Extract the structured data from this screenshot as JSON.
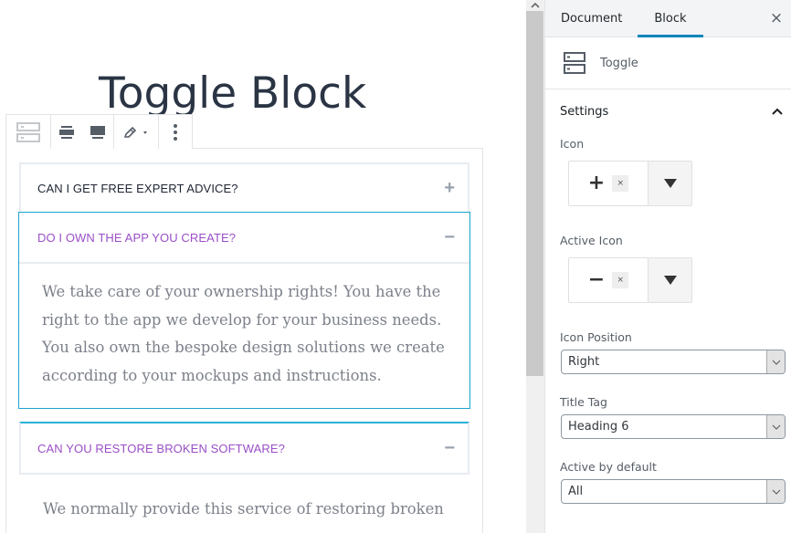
{
  "editor": {
    "post_title": "Toggle Block",
    "toolbar": {
      "block_type_icon": "toggle-block-icon",
      "align_wide_icon": "align-wide-icon",
      "align_full_icon": "align-full-icon",
      "style_icon": "pencil-icon",
      "more_icon": "more-vertical-icon"
    },
    "toggles": [
      {
        "title": "Can I get free expert advice?",
        "state": "collapsed",
        "icon": "+",
        "content": ""
      },
      {
        "title": "Do I own the app you create?",
        "state": "expanded",
        "icon": "−",
        "content": "We take care of your ownership rights! You have the right to the app we develop for your business needs. You also own the bespoke design solutions we create according to your mockups and instructions."
      },
      {
        "title": "Can you restore broken software?",
        "state": "expanded",
        "icon": "−",
        "content": "We normally provide this service of restoring broken"
      }
    ]
  },
  "colors": {
    "active_title": "#9a4fc7",
    "inactive_title": "#1e2533",
    "selection_border": "#1ba3cf",
    "tab_accent": "#0085ba"
  },
  "sidebar": {
    "tabs": [
      {
        "label": "Document",
        "active": false
      },
      {
        "label": "Block",
        "active": true
      }
    ],
    "close_icon": "×",
    "block_card": {
      "name": "Toggle",
      "icon": "toggle-block-icon"
    },
    "panel": {
      "title": "Settings",
      "expanded": true,
      "fields": {
        "icon": {
          "label": "Icon",
          "value": "+",
          "clear": "×"
        },
        "active_icon": {
          "label": "Active Icon",
          "value": "−",
          "clear": "×"
        },
        "icon_position": {
          "label": "Icon Position",
          "value": "Right"
        },
        "title_tag": {
          "label": "Title Tag",
          "value": "Heading 6"
        },
        "active_by_default": {
          "label": "Active by default",
          "value": "All"
        }
      }
    }
  }
}
